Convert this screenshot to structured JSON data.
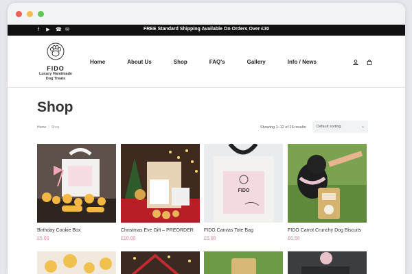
{
  "topbar": {
    "promo": "FREE Standard Shipping Available On Orders Over £30",
    "social_icons": [
      "facebook-icon",
      "youtube-icon",
      "phone-icon",
      "email-icon"
    ]
  },
  "header": {
    "logo": {
      "brand": "FIDO",
      "tagline_1": "Luxury Handmade",
      "tagline_2": "Dog Treats"
    },
    "nav": [
      "Home",
      "About Us",
      "Shop",
      "FAQ's",
      "Gallery",
      "Info / News"
    ],
    "icons": [
      "account-icon",
      "cart-icon"
    ]
  },
  "page": {
    "title": "Shop",
    "breadcrumb": {
      "home": "Home",
      "separator": "/",
      "current": "Shop"
    },
    "results": "Showing 1–12 of 16 results",
    "sort": {
      "selected": "Default sorting"
    }
  },
  "products": [
    {
      "name": "Birthday Cookie Box",
      "price": "£5.00"
    },
    {
      "name": "Christmas Eve Gift – PREORDER",
      "price": "£10.00"
    },
    {
      "name": "FIDO Canvas Tote Bag",
      "price": "£5.00"
    },
    {
      "name": "FIDO Carrot Crunchy Dog Biscuits",
      "price": "£6.50"
    }
  ],
  "colors": {
    "accent_pink": "#e27b8c",
    "topbar": "#111111",
    "traffic_red": "#ee5f56",
    "traffic_yellow": "#f5bd4f",
    "traffic_green": "#5fc753"
  }
}
